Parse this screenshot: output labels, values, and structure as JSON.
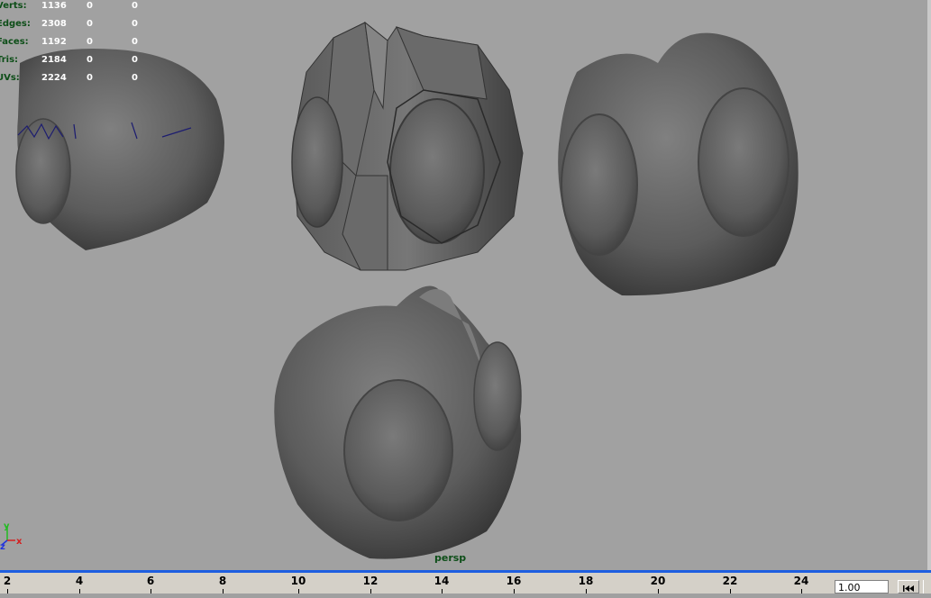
{
  "hud": {
    "rows": [
      {
        "label": "Verts:",
        "v0": "1136",
        "v1": "0",
        "v2": "0"
      },
      {
        "label": "Edges:",
        "v0": "2308",
        "v1": "0",
        "v2": "0"
      },
      {
        "label": "Faces:",
        "v0": "1192",
        "v1": "0",
        "v2": "0"
      },
      {
        "label": "Tris:",
        "v0": "2184",
        "v1": "0",
        "v2": "0"
      },
      {
        "label": "UVs:",
        "v0": "2224",
        "v1": "0",
        "v2": "0"
      }
    ]
  },
  "viewport": {
    "camera": "persp",
    "axis": {
      "x": "x",
      "y": "y",
      "z": "z"
    }
  },
  "timeline": {
    "ticks": [
      "2",
      "4",
      "6",
      "8",
      "10",
      "12",
      "14",
      "16",
      "18",
      "20",
      "22",
      "24"
    ],
    "current_time": "1.00"
  },
  "colors": {
    "viewport_bg": "#a1a1a1",
    "hud_label": "#0d4e18",
    "axis_x": "#d42020",
    "axis_y": "#22bb22",
    "axis_z": "#2233dd",
    "timeline_divider": "#1e5ee0"
  },
  "icons": {
    "goto_start": "goto-start-icon"
  }
}
